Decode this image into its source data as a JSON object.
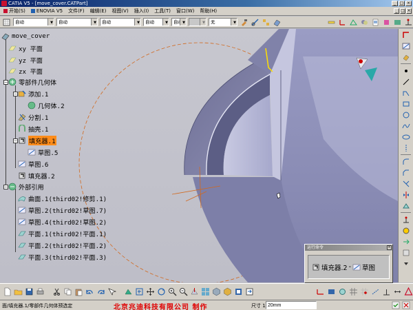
{
  "window": {
    "title": "CATIA V5 - [move_cover.CATPart]",
    "buttons": [
      "_",
      "□",
      "×"
    ]
  },
  "menubar": {
    "items": [
      {
        "label": "开始(S)",
        "icon": "start-icon"
      },
      {
        "label": "ENOVIA V5",
        "icon": "enovia-icon"
      },
      {
        "label": "文件(F)"
      },
      {
        "label": "编辑(E)"
      },
      {
        "label": "视图(V)"
      },
      {
        "label": "插入(I)"
      },
      {
        "label": "工具(T)"
      },
      {
        "label": "窗口(W)"
      },
      {
        "label": "帮助(H)"
      }
    ]
  },
  "property_toolbar": {
    "combos": [
      "自动",
      "自动",
      "自动",
      "自动",
      "自动",
      "",
      "无"
    ]
  },
  "tree": {
    "root": "move_cover",
    "items": [
      {
        "label": "xy 平面",
        "icon": "plane-icon"
      },
      {
        "label": "yz 平面",
        "icon": "plane-icon"
      },
      {
        "label": "zx 平面",
        "icon": "plane-icon"
      },
      {
        "label": "零部件几何体",
        "icon": "part-body-icon"
      },
      {
        "label": "添加.1",
        "icon": "add-operation-icon"
      },
      {
        "label": "几何体.2",
        "icon": "body-icon"
      },
      {
        "label": "分割.1",
        "icon": "split-icon"
      },
      {
        "label": "抽壳.1",
        "icon": "shell-icon"
      },
      {
        "label": "填充器.1",
        "icon": "pad-icon",
        "highlighted": true
      },
      {
        "label": "草图.5",
        "icon": "sketch-icon"
      },
      {
        "label": "草图.6",
        "icon": "sketch-icon"
      },
      {
        "label": "填充器.2",
        "icon": "pad-icon"
      },
      {
        "label": "外部引用",
        "icon": "external-references-icon"
      },
      {
        "label": "曲面.1(third02!修剪.1)",
        "icon": "surface-icon"
      },
      {
        "label": "草图.2(third02!草图.7)",
        "icon": "sketch-icon"
      },
      {
        "label": "草图.4(third02!草图.2)",
        "icon": "sketch-icon"
      },
      {
        "label": "平面.1(third02!平面.1)",
        "icon": "plane-icon"
      },
      {
        "label": "平面.2(third02!平面.2)",
        "icon": "plane-icon"
      },
      {
        "label": "平面.3(third02!平面.3)",
        "icon": "plane-icon"
      }
    ]
  },
  "palette": {
    "title": "运行命令",
    "command": "填充器.2",
    "separator": "-",
    "target": "草图"
  },
  "statusbar": {
    "text": "面/填充器.1/零部件几何体预选定",
    "company": "北京兆迪科技有限公司   制作",
    "dimension_label": "尺寸 1",
    "dimension_value": "20mm"
  },
  "colors": {
    "highlight": "#ff8c1a",
    "model": "#8e8fb2",
    "sketch": "#d2691e",
    "company_text": "#e00000"
  }
}
